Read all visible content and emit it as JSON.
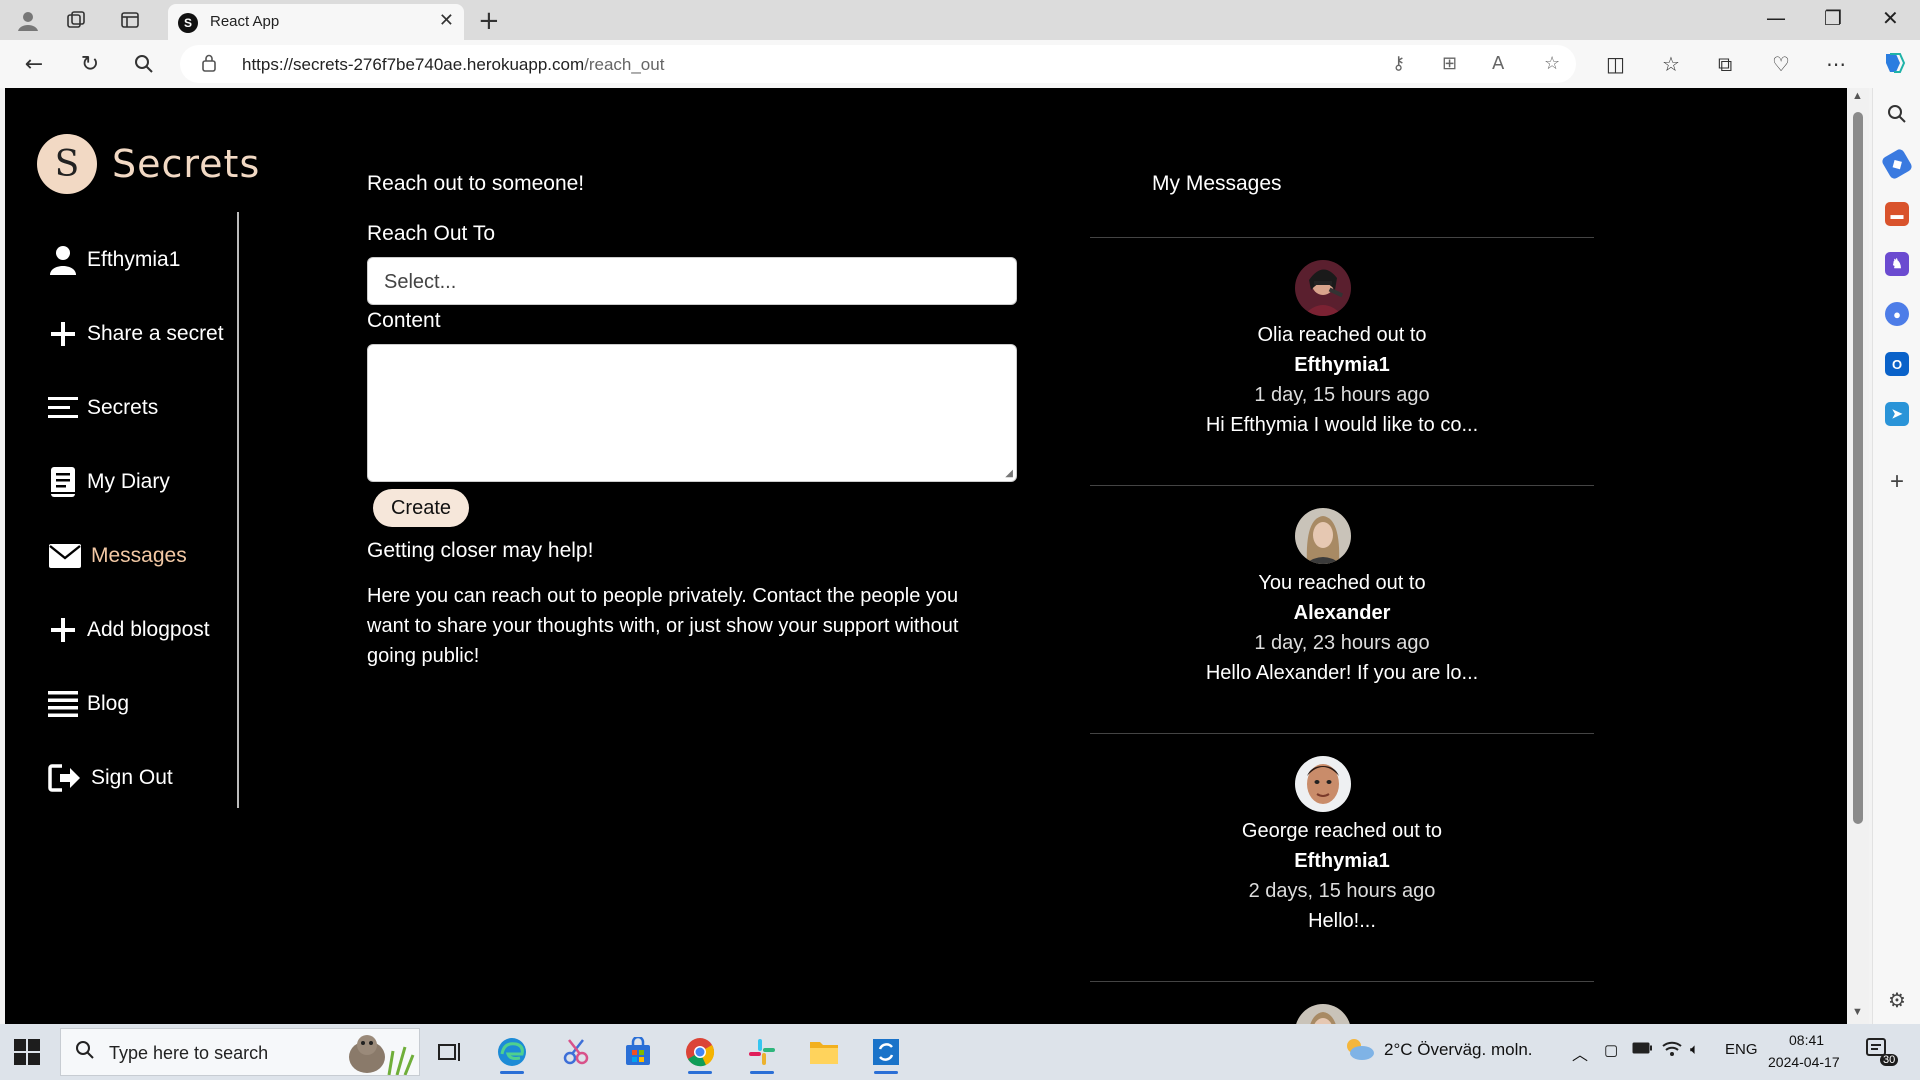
{
  "browser": {
    "tab_title": "React App",
    "tab_favicon": "S",
    "url_host": "https://secrets-276f7be740ae.herokuapp.com",
    "url_path": "/reach_out"
  },
  "app": {
    "logo_letter": "S",
    "logo_text": "Secrets",
    "accent_color": "#f2c8a4"
  },
  "sidebar": {
    "items": [
      {
        "label": "Efthymia1",
        "icon": "user-icon"
      },
      {
        "label": "Share a secret",
        "icon": "plus-icon"
      },
      {
        "label": "Secrets",
        "icon": "lines-icon"
      },
      {
        "label": "My Diary",
        "icon": "diary-icon"
      },
      {
        "label": "Messages",
        "icon": "envelope-icon",
        "active": true
      },
      {
        "label": "Add blogpost",
        "icon": "plus-icon"
      },
      {
        "label": "Blog",
        "icon": "list-icon"
      },
      {
        "label": "Sign Out",
        "icon": "sign-out-icon"
      }
    ]
  },
  "reach_out": {
    "heading": "Reach out to someone!",
    "reach_out_to_label": "Reach Out To",
    "select_placeholder": "Select...",
    "content_label": "Content",
    "create_button": "Create",
    "hint": "Getting closer may help!",
    "description": "Here you can reach out to people privately. Contact the people you want to share your thoughts with, or just show your support without going public!"
  },
  "messages": {
    "heading": "My Messages",
    "items": [
      {
        "action": "Olia reached out to",
        "recipient": "Efthymia1",
        "time": "1 day, 15 hours ago",
        "preview": "Hi Efthymia I would like to co..."
      },
      {
        "action": "You reached out to",
        "recipient": "Alexander",
        "time": "1 day, 23 hours ago",
        "preview": "Hello Alexander! If you are lo..."
      },
      {
        "action": "George reached out to",
        "recipient": "Efthymia1",
        "time": "2 days, 15 hours ago",
        "preview": "Hello!..."
      }
    ]
  },
  "taskbar": {
    "search_placeholder": "Type here to search",
    "weather": "2°C  Överväg. moln.",
    "language": "ENG",
    "time": "08:41",
    "date": "2024-04-17",
    "notifications": "30"
  }
}
